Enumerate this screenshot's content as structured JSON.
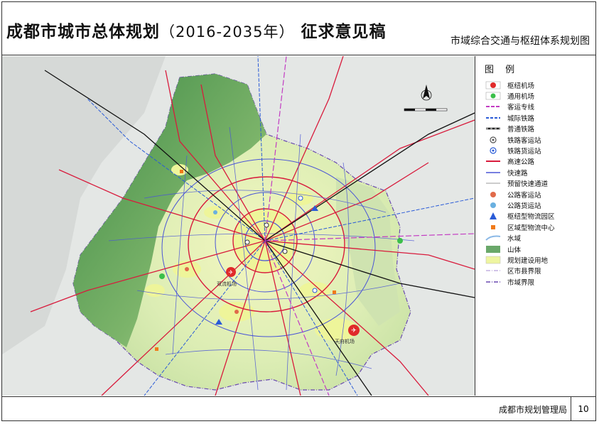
{
  "header": {
    "title": "成都市城市总体规划",
    "years": "（2016-2035年）",
    "draft": "征求意见稿",
    "map_name": "市域综合交通与枢纽体系规划图"
  },
  "legend": {
    "title": "图 例",
    "items": [
      {
        "label": "枢纽机场",
        "icon": "hub-airport-icon",
        "color": "#e02a2a"
      },
      {
        "label": "通用机场",
        "icon": "general-airport-icon",
        "color": "#3bbf4a"
      },
      {
        "label": "客运专线",
        "icon": "passenger-line-icon",
        "color": "#c23bc2"
      },
      {
        "label": "城际铁路",
        "icon": "intercity-rail-icon",
        "color": "#2a5bd7"
      },
      {
        "label": "普通铁路",
        "icon": "railway-icon",
        "color": "#111111"
      },
      {
        "label": "铁路客运站",
        "icon": "rail-passenger-station-icon",
        "color": "#555555"
      },
      {
        "label": "铁路货运站",
        "icon": "rail-freight-station-icon",
        "color": "#2a5bd7"
      },
      {
        "label": "高速公路",
        "icon": "expressway-icon",
        "color": "#d81b3c"
      },
      {
        "label": "快速路",
        "icon": "fast-road-icon",
        "color": "#4a55d6"
      },
      {
        "label": "预留快速通道",
        "icon": "reserved-corridor-icon",
        "color": "#999999"
      },
      {
        "label": "公路客运站",
        "icon": "road-passenger-station-icon",
        "color": "#e06a4a"
      },
      {
        "label": "公路货运站",
        "icon": "road-freight-station-icon",
        "color": "#6ab0e0"
      },
      {
        "label": "枢纽型物流园区",
        "icon": "logistics-park-icon",
        "color": "#2a5bd7"
      },
      {
        "label": "区域型物流中心",
        "icon": "logistics-center-icon",
        "color": "#f07a1a"
      },
      {
        "label": "水域",
        "icon": "water-icon",
        "color": "#8ab8e6"
      },
      {
        "label": "山体",
        "icon": "mountain-icon",
        "color": "#6aa86a"
      },
      {
        "label": "规划建设用地",
        "icon": "planned-land-icon",
        "color": "#eef5a0"
      },
      {
        "label": "区市县界限",
        "icon": "district-boundary-icon",
        "color": "#a58ad0"
      },
      {
        "label": "市域界限",
        "icon": "city-boundary-icon",
        "color": "#6a4ab0"
      }
    ]
  },
  "map": {
    "labels": [
      "双流机场",
      "天府机场"
    ],
    "colors": {
      "mountain": "#5f9e5a",
      "plain": "#d8ecb0",
      "urban": "#eef59a",
      "background": "#eceeed"
    }
  },
  "footer": {
    "agency": "成都市规划管理局",
    "page": "10"
  }
}
